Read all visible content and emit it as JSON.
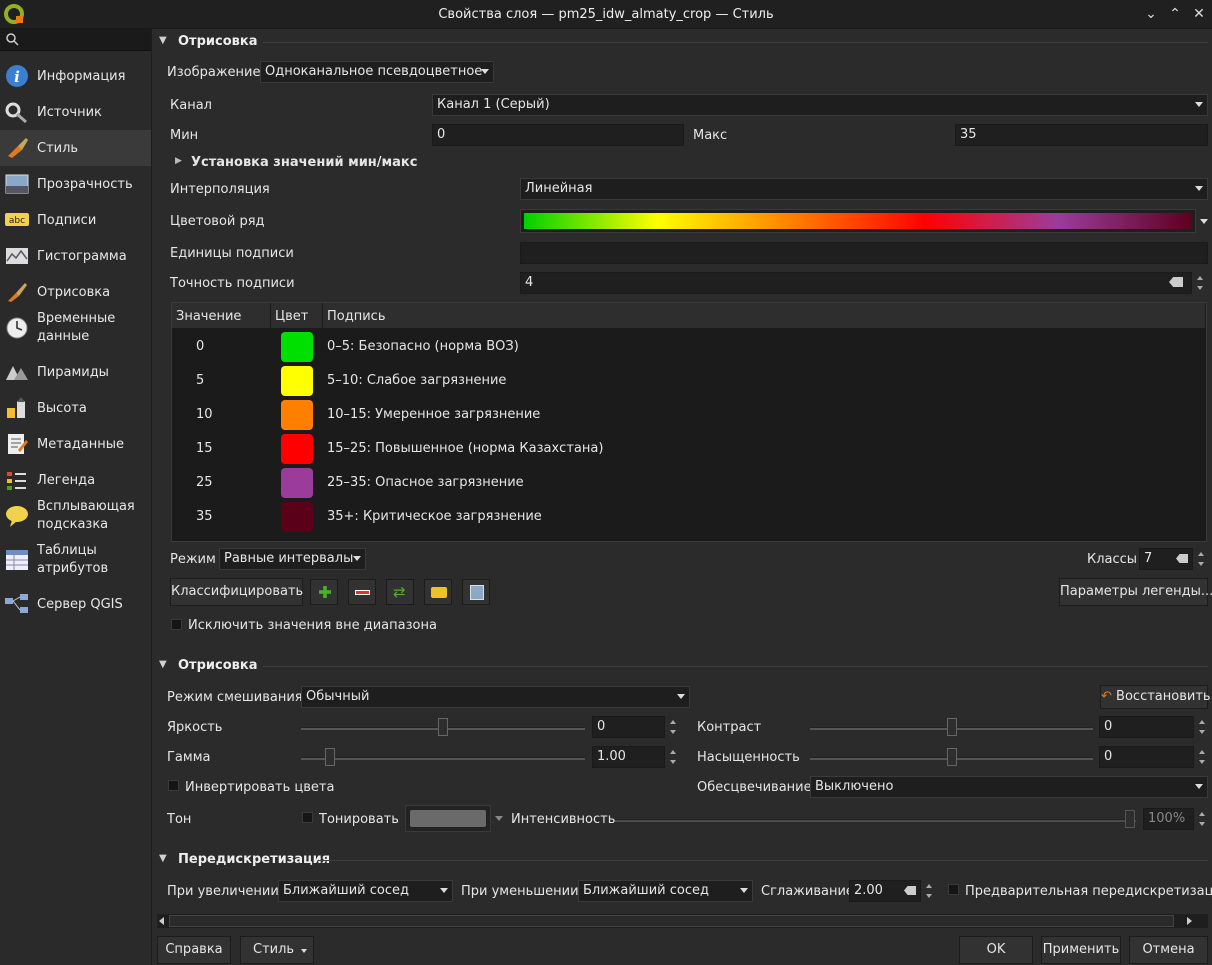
{
  "window": {
    "title": "Свойства слоя — pm25_idw_almaty_crop — Стиль"
  },
  "sidebar": {
    "items": [
      {
        "label": "Информация",
        "icon": "info-icon"
      },
      {
        "label": "Источник",
        "icon": "source-icon"
      },
      {
        "label": "Стиль",
        "icon": "style-brush-icon"
      },
      {
        "label": "Прозрачность",
        "icon": "transparency-icon"
      },
      {
        "label": "Подписи",
        "icon": "labels-abc-icon"
      },
      {
        "label": "Гистограмма",
        "icon": "histogram-icon"
      },
      {
        "label": "Отрисовка",
        "icon": "rendering-brush-icon"
      },
      {
        "label_line1": "Временные",
        "label_line2": "данные",
        "icon": "clock-icon"
      },
      {
        "label": "Пирамиды",
        "icon": "pyramids-icon"
      },
      {
        "label": "Высота",
        "icon": "elevation-icon"
      },
      {
        "label": "Метаданные",
        "icon": "metadata-icon"
      },
      {
        "label": "Легенда",
        "icon": "legend-icon"
      },
      {
        "label_line1": "Всплывающая",
        "label_line2": "подсказка",
        "icon": "tooltip-icon"
      },
      {
        "label_line1": "Таблицы",
        "label_line2": "атрибутов",
        "icon": "attribute-table-icon"
      },
      {
        "label": "Сервер QGIS",
        "icon": "server-icon"
      }
    ]
  },
  "render": {
    "section_title": "Отрисовка",
    "image_label": "Изображение",
    "image_value": "Одноканальное псевдоцветное",
    "band_label": "Канал",
    "band_value": "Канал 1 (Серый)",
    "min_label": "Мин",
    "min_value": "0",
    "max_label": "Макс",
    "max_value": "35",
    "minmax_settings": "Установка значений мин/макс",
    "interp_label": "Интерполяция",
    "interp_value": "Линейная",
    "ramp_label": "Цветовой ряд",
    "ramp_colors": [
      "#00d000",
      "#ffff00",
      "#ff8000",
      "#ff0000",
      "#9b3c9b",
      "#5e0020"
    ],
    "units_label": "Единицы подписи",
    "units_value": "",
    "precision_label": "Точность подписи",
    "precision_value": "4",
    "table_headers": [
      "Значение",
      "Цвет",
      "Подпись"
    ],
    "classes": [
      {
        "value": "0",
        "color": "#00e000",
        "label": "0–5: Безопасно (норма ВОЗ)"
      },
      {
        "value": "5",
        "color": "#ffff00",
        "label": "5–10: Слабое загрязнение"
      },
      {
        "value": "10",
        "color": "#ff8000",
        "label": "10–15: Умеренное загрязнение"
      },
      {
        "value": "15",
        "color": "#ff0000",
        "label": "15–25: Повышенное (норма Казахстана)"
      },
      {
        "value": "25",
        "color": "#9b3c9b",
        "label": "25–35: Опасное загрязнение"
      },
      {
        "value": "35",
        "color": "#5a0018",
        "label": "35+: Критическое загрязнение"
      }
    ],
    "mode_label": "Режим",
    "mode_value": "Равные интервалы",
    "classes_label": "Классы",
    "classes_value": "7",
    "classify_button": "Классифицировать",
    "legend_params_button": "Параметры легенды...",
    "clip_out_of_range": "Исключить значения вне диапазона"
  },
  "layer_render": {
    "section_title": "Отрисовка",
    "blend_label": "Режим смешивания",
    "blend_value": "Обычный",
    "reset_button": "Восстановить",
    "brightness_label": "Яркость",
    "brightness_value": "0",
    "contrast_label": "Контраст",
    "contrast_value": "0",
    "gamma_label": "Гамма",
    "gamma_value": "1.00",
    "saturation_label": "Насыщенность",
    "saturation_value": "0",
    "invert_label": "Инвертировать цвета",
    "grayscale_label": "Обесцвечивание",
    "grayscale_value": "Выключено",
    "hue_label": "Тон",
    "colorize_label": "Тонировать",
    "intensity_label": "Интенсивность",
    "intensity_value": "100%"
  },
  "resampling": {
    "section_title": "Передискретизация",
    "zoomed_in_label": "При увеличении",
    "zoomed_in_value": "Ближайший сосед",
    "zoomed_out_label": "При уменьшении",
    "zoomed_out_value": "Ближайший сосед",
    "oversampling_label": "Сглаживание",
    "oversampling_value": "2.00",
    "early_resampling_label": "Предварительная передискретизация"
  },
  "footer": {
    "help": "Справка",
    "style": "Стиль",
    "ok": "OK",
    "apply": "Применить",
    "cancel": "Отмена"
  }
}
